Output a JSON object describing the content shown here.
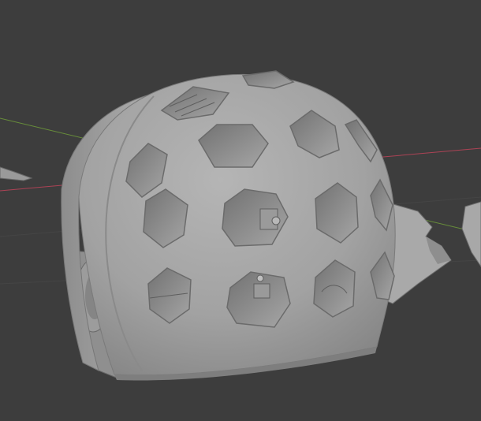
{
  "viewport": {
    "name": "3D Viewport",
    "background": "#3d3d3d",
    "grid_line_color": "#4a4a4a",
    "x_axis_color": "#c0445a",
    "y_axis_color": "#6f9b3a"
  },
  "scene": {
    "object": "helmet-shell",
    "object_color": "#a3a3a3",
    "object_shadow_color": "#6f6f6f",
    "hole_interior_color": "#8a8a8a",
    "hole_shape": "hexagon",
    "hole_count_visible": 16,
    "auxiliary_parts": [
      "left-fragment",
      "left-cheek-guard",
      "right-fin-part",
      "right-edge-part"
    ]
  }
}
